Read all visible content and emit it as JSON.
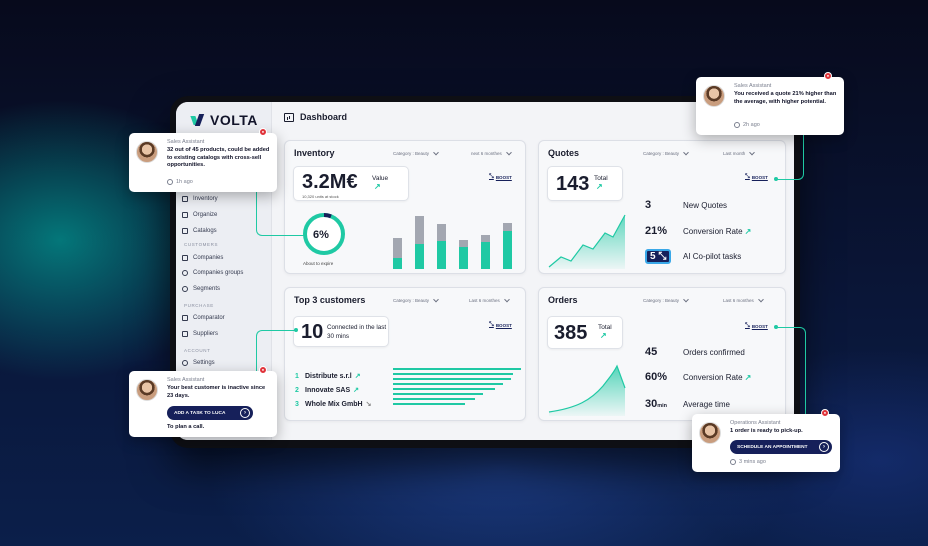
{
  "app": {
    "name": "VOLTA",
    "page_title": "Dashboard"
  },
  "sidebar": {
    "items_top": [
      {
        "label": "Inventory",
        "icon": "inventory-icon"
      },
      {
        "label": "Organize",
        "icon": "organize-icon"
      },
      {
        "label": "Catalogs",
        "icon": "catalog-icon"
      }
    ],
    "section_customers": "CUSTOMERS",
    "items_customers": [
      {
        "label": "Companies",
        "icon": "companies-icon"
      },
      {
        "label": "Companies groups",
        "icon": "globe-icon"
      },
      {
        "label": "Segments",
        "icon": "segments-icon"
      }
    ],
    "section_purchase": "PURCHASE",
    "items_purchase": [
      {
        "label": "Comparator",
        "icon": "comparator-icon"
      },
      {
        "label": "Suppliers",
        "icon": "suppliers-icon"
      }
    ],
    "section_account": "ACCOUNT",
    "items_account": [
      {
        "label": "Settings",
        "icon": "settings-icon"
      }
    ]
  },
  "inventory": {
    "title": "Inventory",
    "filter_category": "Category : Beauty",
    "filter_period": "next 6 monthes",
    "value": "3.2M€",
    "value_label": "Value",
    "units": "10,320 units at stock",
    "boost": "BOOST",
    "donut_percent": "6%",
    "donut_fraction": 0.06,
    "donut_label": "About to expire",
    "bars": [
      {
        "top": 0.35,
        "bottom": 0.2
      },
      {
        "top": 0.5,
        "bottom": 0.45
      },
      {
        "top": 0.3,
        "bottom": 0.5
      },
      {
        "top": 0.12,
        "bottom": 0.4
      },
      {
        "top": 0.12,
        "bottom": 0.48
      },
      {
        "top": 0.15,
        "bottom": 0.68
      }
    ]
  },
  "quotes": {
    "title": "Quotes",
    "filter_category": "Category : Beauty",
    "filter_period": "Last month",
    "total": "143",
    "total_label": "Total",
    "boost": "BOOST",
    "stats": [
      {
        "value": "3",
        "label": "New Quotes",
        "arrow": ""
      },
      {
        "value": "21%",
        "label": "Conversion Rate",
        "arrow": "↗"
      },
      {
        "value": "5",
        "label": "AI Co-pilot tasks",
        "arrow": ""
      }
    ]
  },
  "customers": {
    "title": "Top 3 customers",
    "filter_category": "Category : Beauty",
    "filter_period": "Last 6 monthes",
    "count": "10",
    "count_label": "Connected in the last 30 mins",
    "boost": "BOOST",
    "list": [
      {
        "rank": "1",
        "name": "Distribute s.r.l",
        "arrow": "↗"
      },
      {
        "rank": "2",
        "name": "Innovate SAS",
        "arrow": "↗"
      },
      {
        "rank": "3",
        "name": "Whole Mix GmbH",
        "arrow": "↘"
      }
    ]
  },
  "orders": {
    "title": "Orders",
    "filter_category": "Category : Beauty",
    "filter_period": "Last 6 monthes",
    "total": "385",
    "total_label": "Total",
    "boost": "BOOST",
    "stats": [
      {
        "value": "45",
        "unit": "",
        "label": "Orders confirmed",
        "arrow": ""
      },
      {
        "value": "60%",
        "unit": "",
        "label": "Conversion Rate",
        "arrow": "↗"
      },
      {
        "value": "30",
        "unit": "min",
        "label": "Average time",
        "arrow": ""
      }
    ]
  },
  "popups": {
    "p1": {
      "role": "Sales Assistant",
      "message": "32 out of 45 products, could be added to existing catalogs with cross-sell opportunities.",
      "time": "1h ago"
    },
    "p2": {
      "role": "Sales Assistant",
      "message": "You received a quote 21% higher than the average, with higher potential.",
      "time": "2h ago"
    },
    "p3": {
      "role": "Sales Assistant",
      "message": "Your best customer is inactive since 23 days.",
      "button": "ADD A TASK TO LUCA",
      "footer": "To plan a call."
    },
    "p4": {
      "role": "Operations Assistant",
      "message": "1 order is ready to pick-up.",
      "button": "SCHEDULE AN APPOINTMENT",
      "time": "3 mins ago"
    }
  },
  "colors": {
    "accent": "#1fc9a4",
    "navy": "#16205a",
    "alert": "#e0333a"
  }
}
